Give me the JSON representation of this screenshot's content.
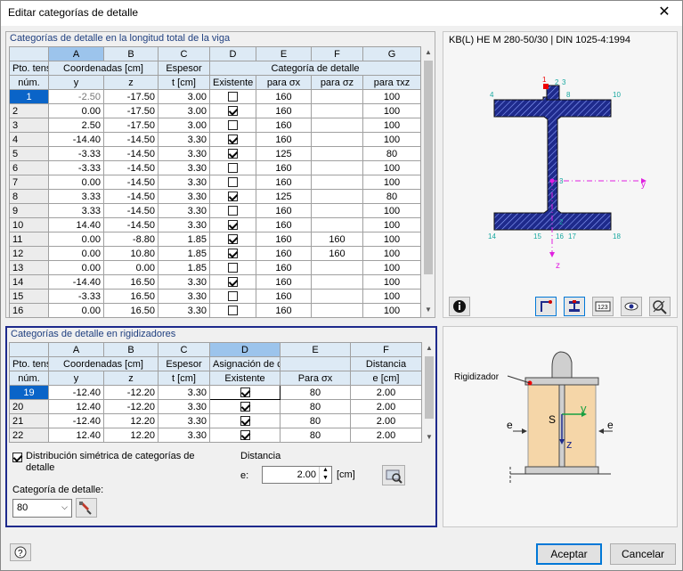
{
  "window": {
    "title": "Editar categorías de detalle"
  },
  "upper": {
    "title": "Categorías de detalle en la longitud total de la viga",
    "col_letters": [
      "A",
      "B",
      "C",
      "D",
      "E",
      "F",
      "G"
    ],
    "h1": {
      "pto": "Pto. tens.",
      "coords": "Coordenadas [cm]",
      "espesor": "Espesor",
      "categoria": "Categoría de detalle"
    },
    "h2": {
      "num": "núm.",
      "y": "y",
      "z": "z",
      "t": "t [cm]",
      "existente": "Existente",
      "sx": "para σx",
      "sz": "para σz",
      "txz": "para τxz"
    },
    "rows": [
      [
        "1",
        "-2.50",
        "-17.50",
        "3.00",
        false,
        "160",
        "",
        "100"
      ],
      [
        "2",
        "0.00",
        "-17.50",
        "3.00",
        true,
        "160",
        "",
        "100"
      ],
      [
        "3",
        "2.50",
        "-17.50",
        "3.00",
        false,
        "160",
        "",
        "100"
      ],
      [
        "4",
        "-14.40",
        "-14.50",
        "3.30",
        true,
        "160",
        "",
        "100"
      ],
      [
        "5",
        "-3.33",
        "-14.50",
        "3.30",
        true,
        "125",
        "",
        "80"
      ],
      [
        "6",
        "-3.33",
        "-14.50",
        "3.30",
        false,
        "160",
        "",
        "100"
      ],
      [
        "7",
        "0.00",
        "-14.50",
        "3.30",
        false,
        "160",
        "",
        "100"
      ],
      [
        "8",
        "3.33",
        "-14.50",
        "3.30",
        true,
        "125",
        "",
        "80"
      ],
      [
        "9",
        "3.33",
        "-14.50",
        "3.30",
        false,
        "160",
        "",
        "100"
      ],
      [
        "10",
        "14.40",
        "-14.50",
        "3.30",
        true,
        "160",
        "",
        "100"
      ],
      [
        "11",
        "0.00",
        "-8.80",
        "1.85",
        true,
        "160",
        "160",
        "100"
      ],
      [
        "12",
        "0.00",
        "10.80",
        "1.85",
        true,
        "160",
        "160",
        "100"
      ],
      [
        "13",
        "0.00",
        "0.00",
        "1.85",
        false,
        "160",
        "",
        "100"
      ],
      [
        "14",
        "-14.40",
        "16.50",
        "3.30",
        true,
        "160",
        "",
        "100"
      ],
      [
        "15",
        "-3.33",
        "16.50",
        "3.30",
        false,
        "160",
        "",
        "100"
      ],
      [
        "16",
        "0.00",
        "16.50",
        "3.30",
        false,
        "160",
        "",
        "100"
      ]
    ]
  },
  "lower": {
    "title": "Categorías de detalle en rigidizadores",
    "col_letters": [
      "A",
      "B",
      "C",
      "D",
      "E",
      "F"
    ],
    "h1": {
      "pto": "Pto. tens.",
      "coords": "Coordenadas [cm]",
      "espesor": "Espesor",
      "asignacion": "Asignación de categoría de detal",
      "distancia": "Distancia"
    },
    "h2": {
      "num": "núm.",
      "y": "y",
      "z": "z",
      "t": "t [cm]",
      "existente": "Existente",
      "sx": "Para σx",
      "e": "e [cm]"
    },
    "rows": [
      [
        "19",
        "-12.40",
        "-12.20",
        "3.30",
        true,
        "80",
        "2.00"
      ],
      [
        "20",
        "12.40",
        "-12.20",
        "3.30",
        true,
        "80",
        "2.00"
      ],
      [
        "21",
        "-12.40",
        "12.20",
        "3.30",
        true,
        "80",
        "2.00"
      ],
      [
        "22",
        "12.40",
        "12.20",
        "3.30",
        true,
        "80",
        "2.00"
      ]
    ],
    "sym_label": "Distribución simétrica de categorías de detalle",
    "sym_checked": true,
    "dist_label": "Distancia",
    "e_label": "e:",
    "e_value": "2.00",
    "unit": "[cm]",
    "cat_label": "Categoría de detalle:",
    "cat_value": "80"
  },
  "preview": {
    "section_title": "KB(L) HE M 280-50/30 | DIN 1025-4:1994",
    "pts": {
      "p1": "1",
      "p2": "2",
      "p3": "3",
      "p4": "4",
      "p8": "8",
      "p10": "10",
      "p14": "14",
      "p15": "15",
      "p16": "16",
      "p17": "17",
      "p18": "18",
      "pm2": "2",
      "pm3": "3"
    },
    "axis_y": "y",
    "axis_z": "z",
    "stiff_label": "Rigidizador",
    "s": "S",
    "y": "y",
    "z": "z",
    "e": "e"
  },
  "buttons": {
    "ok": "Aceptar",
    "cancel": "Cancelar"
  },
  "colors": {
    "accent": "#0a64c8",
    "header": "#ddeaf5",
    "section": "#1e2a8c",
    "stiffener": "#f5d6a8"
  }
}
